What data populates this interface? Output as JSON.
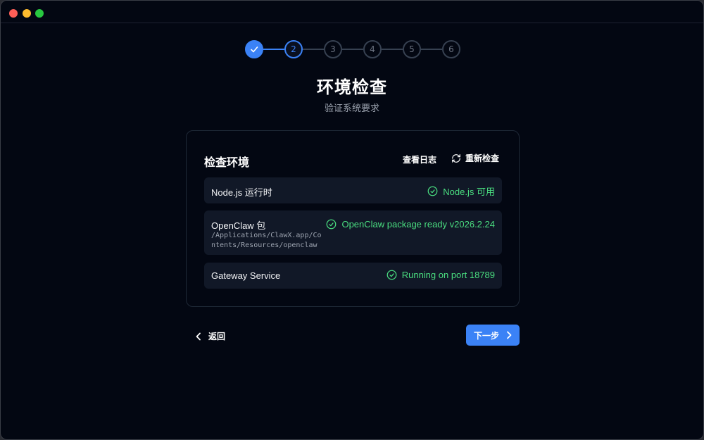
{
  "stepper": {
    "steps": [
      {
        "label": "✓",
        "state": "done"
      },
      {
        "label": "2",
        "state": "active"
      },
      {
        "label": "3",
        "state": "pending"
      },
      {
        "label": "4",
        "state": "pending"
      },
      {
        "label": "5",
        "state": "pending"
      },
      {
        "label": "6",
        "state": "pending"
      }
    ]
  },
  "page": {
    "title": "环境检查",
    "subtitle": "验证系统要求"
  },
  "card": {
    "title": "检查环境",
    "view_log_label": "查看日志",
    "recheck_label": "重新检查",
    "checks": [
      {
        "label": "Node.js 运行时",
        "status": "Node.js 可用"
      },
      {
        "label": "OpenClaw 包",
        "path": "/Applications/ClawX.app/Contents/Resources/openclaw",
        "status": "OpenClaw package ready v2026.2.24"
      },
      {
        "label": "Gateway Service",
        "status": "Running on port 18789"
      }
    ]
  },
  "nav": {
    "back_label": "返回",
    "next_label": "下一步"
  },
  "colors": {
    "accent": "#3b82f6",
    "success": "#4ade80",
    "background": "#030712"
  }
}
